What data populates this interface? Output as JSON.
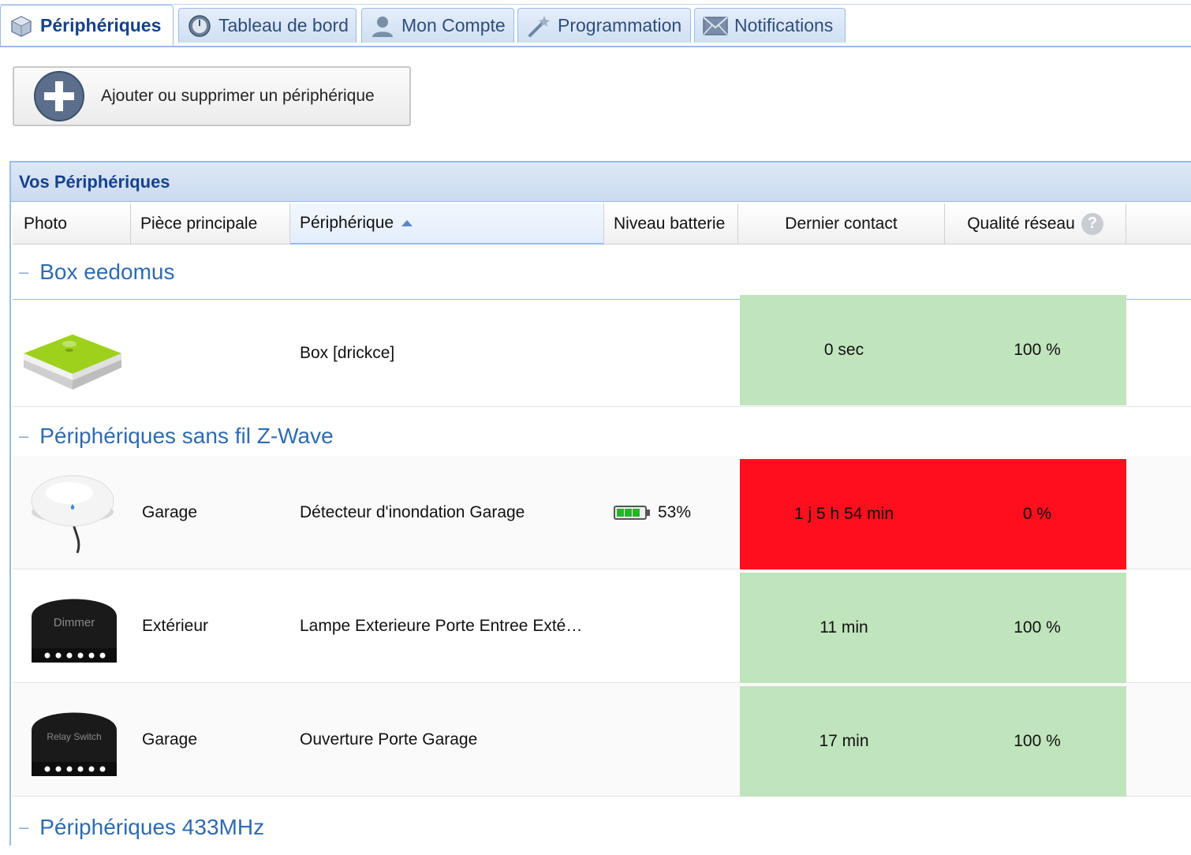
{
  "tabs": [
    {
      "label": "Périphériques",
      "icon": "cube-icon",
      "active": true
    },
    {
      "label": "Tableau de bord",
      "icon": "dashboard-icon",
      "active": false
    },
    {
      "label": "Mon Compte",
      "icon": "user-icon",
      "active": false
    },
    {
      "label": "Programmation",
      "icon": "magic-wand-icon",
      "active": false
    },
    {
      "label": "Notifications",
      "icon": "envelope-icon",
      "active": false
    }
  ],
  "add_button": {
    "label": "Ajouter ou supprimer un périphérique",
    "icon": "plus-circle-icon"
  },
  "panel": {
    "title": "Vos Périphériques",
    "columns": {
      "photo": "Photo",
      "room": "Pièce principale",
      "device": "Périphérique",
      "battery": "Niveau batterie",
      "last_contact": "Dernier contact",
      "network": "Qualité réseau"
    },
    "sorted_column": "device",
    "sort_direction": "ascending"
  },
  "groups": [
    {
      "title": "Box eedomus",
      "rows": [
        {
          "photo": "eedomus-box-image",
          "room": "",
          "device": "Box [drickce]",
          "battery": "",
          "last_contact": "0 sec",
          "network": "100 %",
          "status": "ok"
        }
      ]
    },
    {
      "title": "Périphériques sans fil Z-Wave",
      "rows": [
        {
          "photo": "flood-sensor-image",
          "room": "Garage",
          "device": "Détecteur d'inondation Garage",
          "battery": "53%",
          "battery_level": 0.53,
          "last_contact": "1 j 5 h 54 min",
          "network": "0 %",
          "status": "error"
        },
        {
          "photo": "dimmer-module-image",
          "room": "Extérieur",
          "device": "Lampe Exterieure Porte Entree Exté…",
          "battery": "",
          "last_contact": "11 min",
          "network": "100 %",
          "status": "ok"
        },
        {
          "photo": "relay-switch-image",
          "room": "Garage",
          "device": "Ouverture Porte Garage",
          "battery": "",
          "last_contact": "17 min",
          "network": "100 %",
          "status": "ok"
        }
      ]
    },
    {
      "title": "Périphériques 433MHz",
      "rows": []
    }
  ],
  "device_labels": {
    "dimmer": "Dimmer",
    "relay": "Relay Switch"
  },
  "colors": {
    "ok": "#c0e4bc",
    "error": "#ff0f1e",
    "accent": "#15428b",
    "group_title": "#2f6bb0"
  }
}
